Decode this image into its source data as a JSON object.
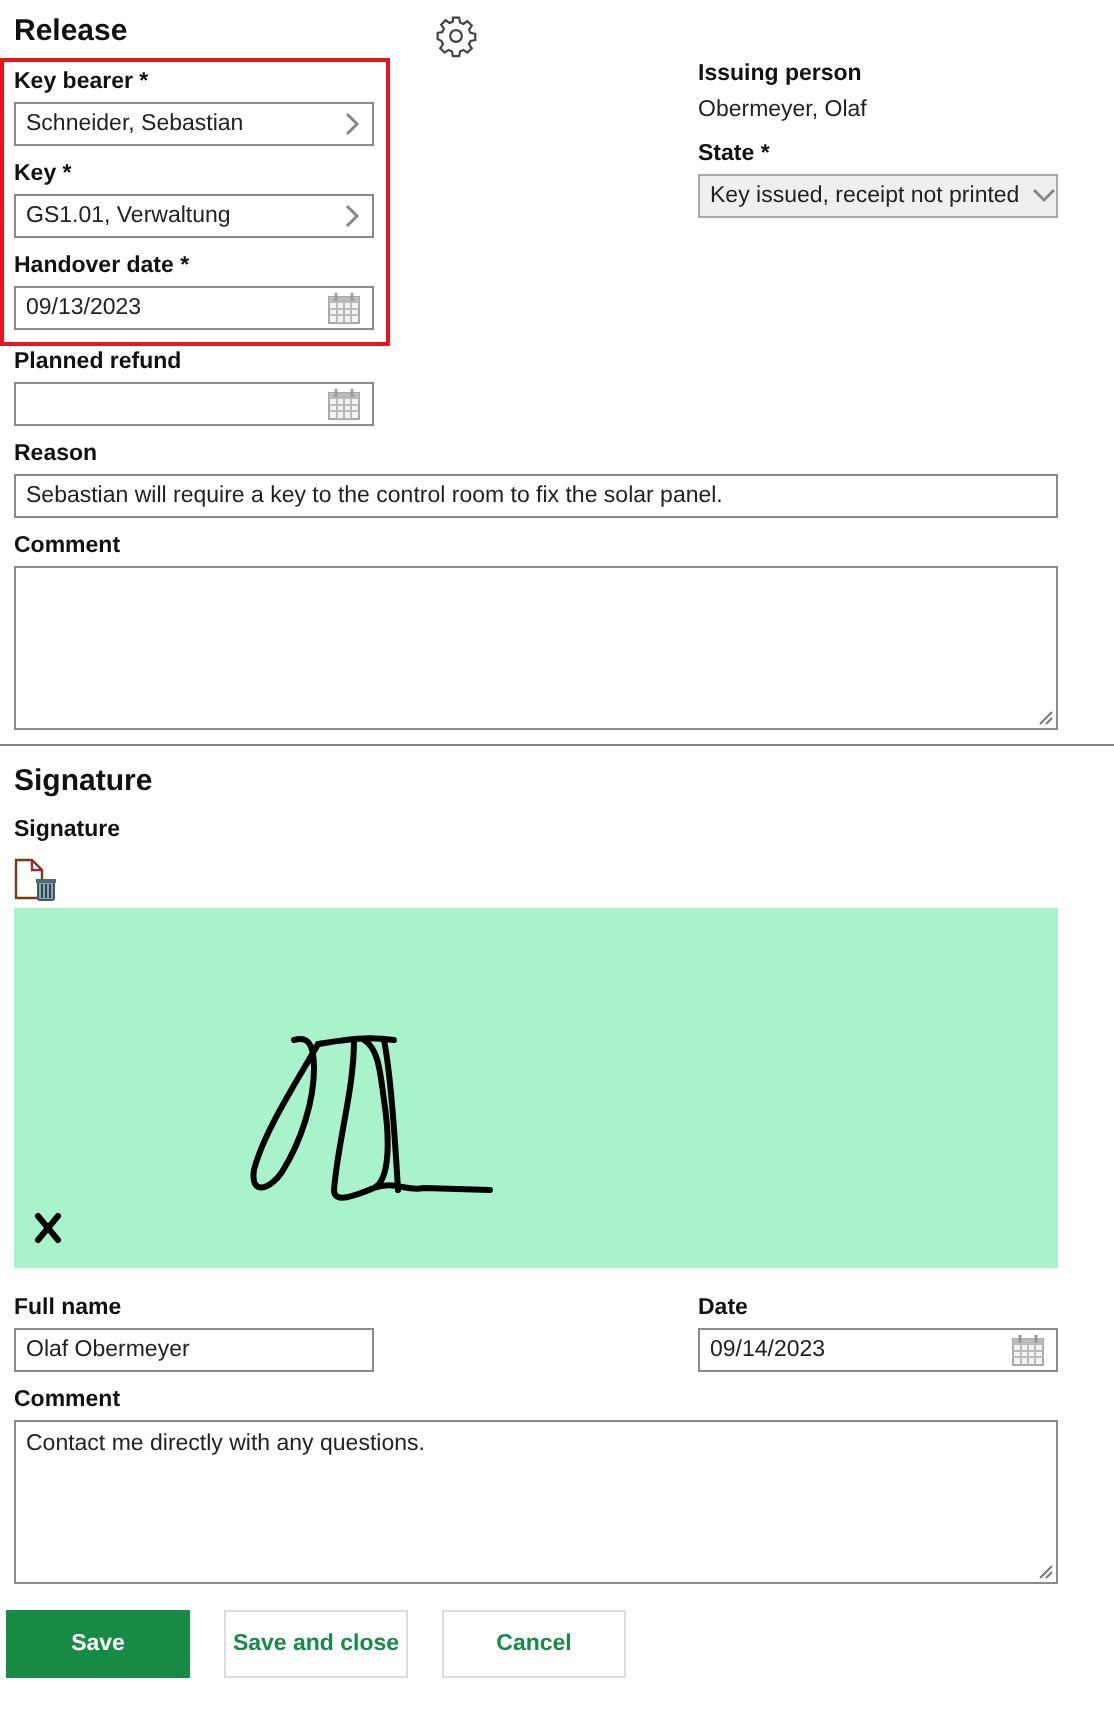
{
  "release": {
    "title": "Release",
    "left_fields": [
      {
        "kind": "lookup",
        "label": "Key bearer *",
        "value": "Schneider, Sebastian",
        "highlighted": true
      },
      {
        "kind": "lookup",
        "label": "Key *",
        "value": "GS1.01, Verwaltung",
        "highlighted": true
      },
      {
        "kind": "date",
        "label": "Handover date *",
        "value": "09/13/2023",
        "highlighted": true
      },
      {
        "kind": "date",
        "label": "Planned refund",
        "highlighted": false
      }
    ],
    "right_fields": [
      {
        "kind": "readonly",
        "label": "Issuing person",
        "value": "Obermeyer, Olaf"
      },
      {
        "kind": "select",
        "label": "State *",
        "value": "Key issued, receipt not printed"
      }
    ],
    "wide_fields": [
      {
        "kind": "text",
        "label": "Reason",
        "value": "Sebastian will require a key to the control room to fix the solar panel."
      },
      {
        "kind": "textarea",
        "label": "Comment"
      }
    ]
  },
  "signature": {
    "title": "Signature",
    "label": "Signature",
    "signed": true,
    "fields": [
      {
        "kind": "text",
        "label": "Full name",
        "value": "Olaf Obermeyer"
      },
      {
        "kind": "date",
        "label": "Date",
        "value": "09/14/2023"
      }
    ],
    "comment": {
      "label": "Comment",
      "value": "Contact me directly with any questions."
    }
  },
  "buttons": [
    {
      "label": "Save",
      "primary": true
    },
    {
      "label": "Save and close",
      "primary": false
    },
    {
      "label": "Cancel",
      "primary": false
    }
  ]
}
